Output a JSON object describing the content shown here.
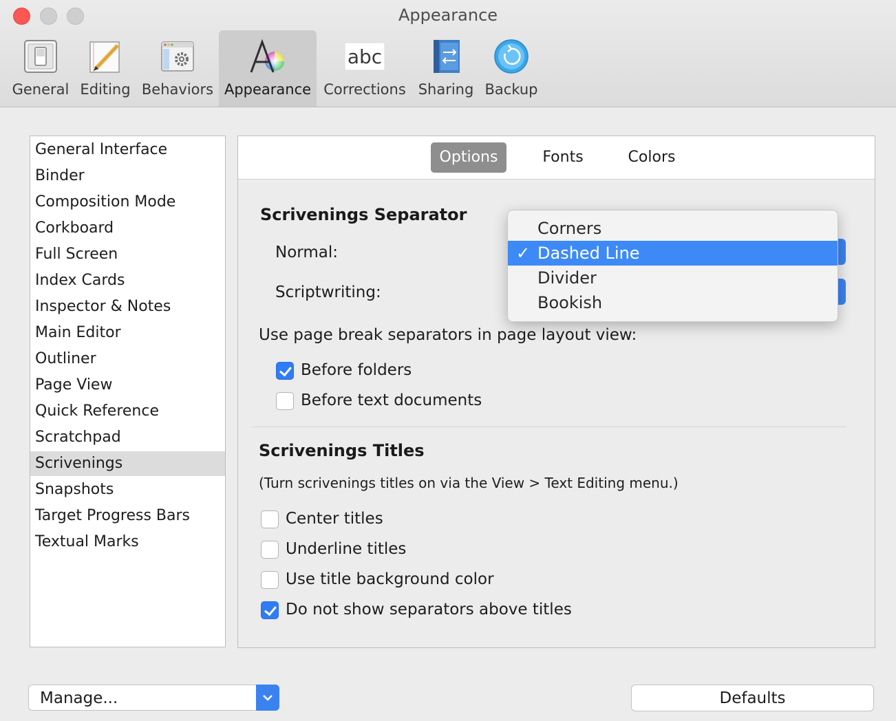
{
  "window": {
    "title": "Appearance"
  },
  "toolbar": {
    "items": [
      {
        "label": "General",
        "icon": "general-switch-icon"
      },
      {
        "label": "Editing",
        "icon": "editing-pencil-icon"
      },
      {
        "label": "Behaviors",
        "icon": "behaviors-gear-icon"
      },
      {
        "label": "Appearance",
        "icon": "appearance-color-icon"
      },
      {
        "label": "Corrections",
        "icon": "corrections-abc-icon"
      },
      {
        "label": "Sharing",
        "icon": "sharing-arrows-icon"
      },
      {
        "label": "Backup",
        "icon": "backup-refresh-icon"
      }
    ],
    "selected": "Appearance"
  },
  "sidebar": {
    "items": [
      "General Interface",
      "Binder",
      "Composition Mode",
      "Corkboard",
      "Full Screen",
      "Index Cards",
      "Inspector & Notes",
      "Main Editor",
      "Outliner",
      "Page View",
      "Quick Reference",
      "Scratchpad",
      "Scrivenings",
      "Snapshots",
      "Target Progress Bars",
      "Textual Marks"
    ],
    "selected": "Scrivenings"
  },
  "tabs": {
    "items": [
      "Options",
      "Fonts",
      "Colors"
    ],
    "selected": "Options"
  },
  "separator_section": {
    "heading": "Scrivenings Separator",
    "normal_label": "Normal:",
    "scriptwriting_label": "Scriptwriting:",
    "dropdown": {
      "options": [
        "Corners",
        "Dashed Line",
        "Divider",
        "Bookish"
      ],
      "selected": "Dashed Line",
      "check_mark": "✓"
    },
    "page_break_label": "Use page break separators in page layout view:",
    "before_folders": {
      "label": "Before folders",
      "checked": true
    },
    "before_text_documents": {
      "label": "Before text documents",
      "checked": false
    }
  },
  "titles_section": {
    "heading": "Scrivenings Titles",
    "note": "(Turn scrivenings titles on via the View > Text Editing menu.)",
    "center_titles": {
      "label": "Center titles",
      "checked": false
    },
    "underline_titles": {
      "label": "Underline titles",
      "checked": false
    },
    "title_background": {
      "label": "Use title background color",
      "checked": false
    },
    "no_separators": {
      "label": "Do not show separators above titles",
      "checked": true
    }
  },
  "footer": {
    "manage_label": "Manage...",
    "defaults_label": "Defaults"
  },
  "colors": {
    "accent": "#3d8af7",
    "close": "#fc5753",
    "selected_tab": "#8e8e8e"
  }
}
